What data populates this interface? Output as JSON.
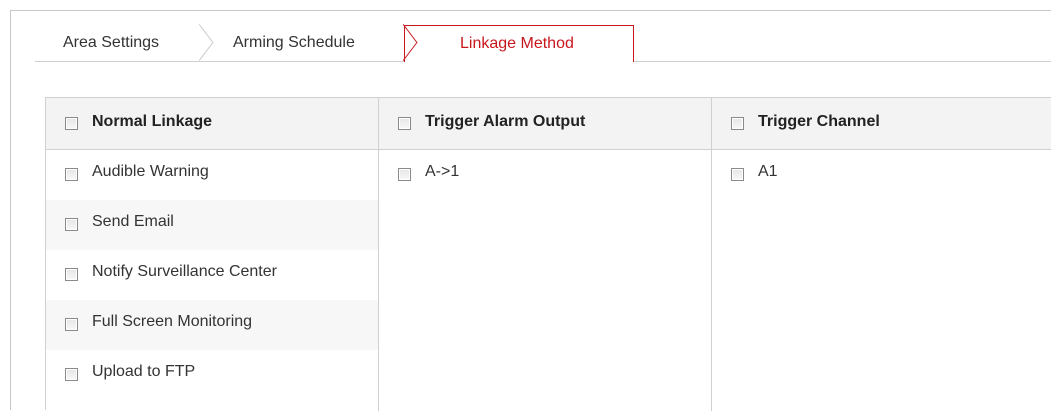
{
  "tabs": {
    "area_settings": "Area Settings",
    "arming_schedule": "Arming Schedule",
    "linkage_method": "Linkage Method",
    "active": "linkage_method",
    "active_color": "#c8161d"
  },
  "columns": [
    {
      "header": "Normal Linkage",
      "checked": false,
      "items": [
        {
          "label": "Audible Warning",
          "checked": false
        },
        {
          "label": "Send Email",
          "checked": false
        },
        {
          "label": "Notify Surveillance Center",
          "checked": false
        },
        {
          "label": "Full Screen Monitoring",
          "checked": false
        },
        {
          "label": "Upload to FTP",
          "checked": false
        }
      ]
    },
    {
      "header": "Trigger Alarm Output",
      "checked": false,
      "items": [
        {
          "label": "A->1",
          "checked": false
        }
      ]
    },
    {
      "header": "Trigger Channel",
      "checked": false,
      "items": [
        {
          "label": "A1",
          "checked": false
        }
      ]
    }
  ]
}
